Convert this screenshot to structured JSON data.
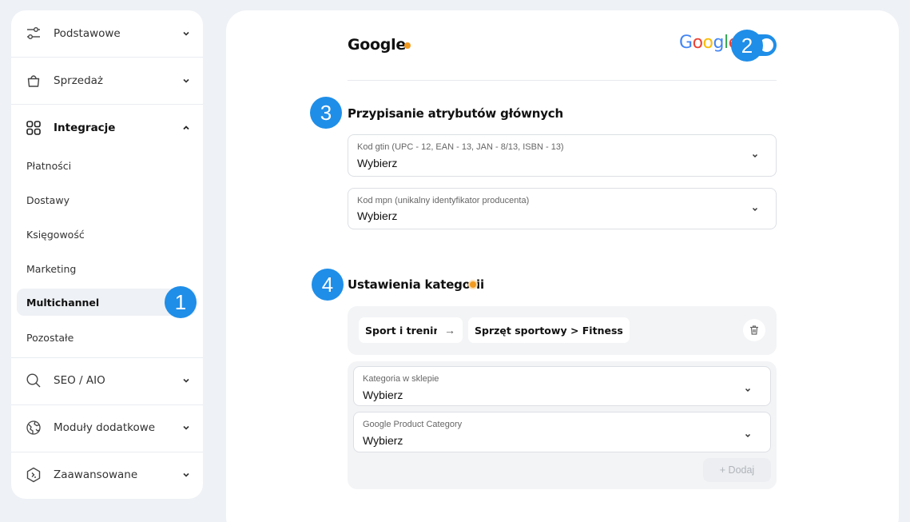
{
  "sidebar": {
    "sections": [
      {
        "label": "Podstawowe",
        "icon": "sliders-icon"
      },
      {
        "label": "Sprzedaż",
        "icon": "shopping-bag-icon"
      },
      {
        "label": "Integracje",
        "icon": "grid-icon"
      },
      {
        "label": "SEO / AIO",
        "icon": "search-icon"
      },
      {
        "label": "Moduły dodatkowe",
        "icon": "globe-icon"
      },
      {
        "label": "Zaawansowane",
        "icon": "code-hexagon-icon"
      }
    ],
    "subitems": [
      "Płatności",
      "Dostawy",
      "Księgowość",
      "Marketing",
      "Multichannel",
      "Pozostałe"
    ],
    "active_subitem": "Multichannel"
  },
  "badges": [
    "1",
    "2",
    "3",
    "4"
  ],
  "header": {
    "title": "Google",
    "logo_text": "Google",
    "toggle_on": true
  },
  "attributes": {
    "heading": "Przypisanie atrybutów głównych",
    "fields": [
      {
        "label": "Kod gtin (UPC - 12, EAN - 13, JAN - 8/13, ISBN - 13)",
        "value": "Wybierz"
      },
      {
        "label": "Kod mpn (unikalny identyfikator producenta)",
        "value": "Wybierz"
      }
    ]
  },
  "categories": {
    "heading": "Ustawienia kategorii",
    "mapping": {
      "from": "Sport i trening",
      "arrow": "→",
      "to": "Sprzęt sportowy > Fitness"
    },
    "fields": [
      {
        "label": "Kategoria w sklepie",
        "value": "Wybierz"
      },
      {
        "label": "Google Product Category",
        "value": "Wybierz"
      }
    ],
    "add_label": "+ Dodaj"
  },
  "colors": {
    "accent": "#1f8ee8",
    "status_dot": "#f29a1f"
  }
}
